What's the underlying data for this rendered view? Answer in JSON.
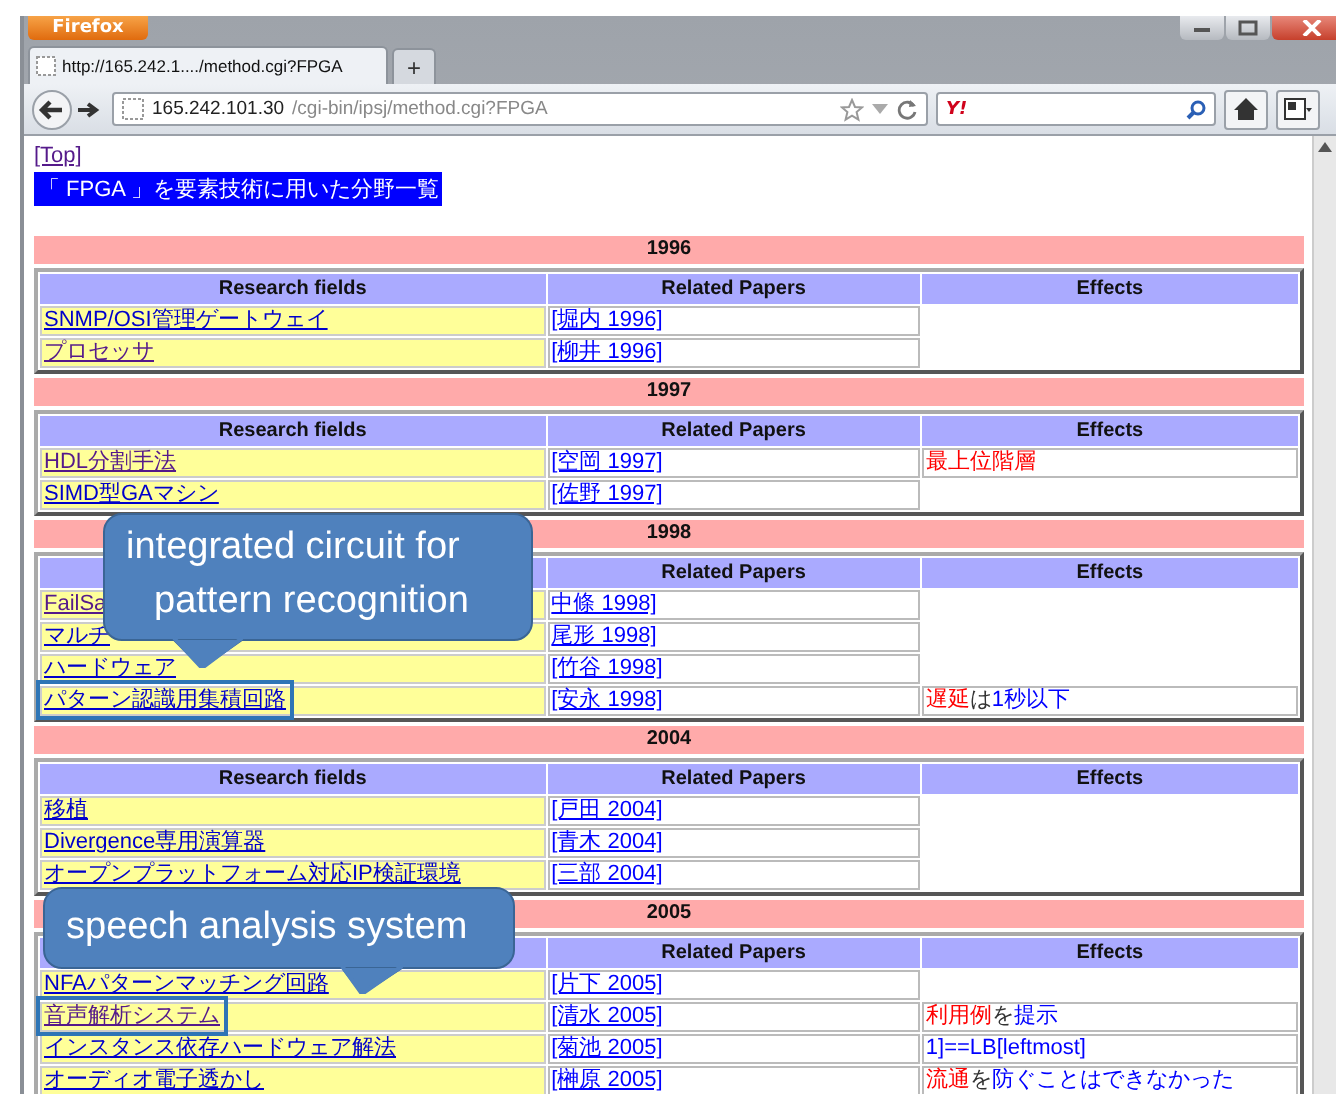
{
  "browser": {
    "menu_button": "Firefox",
    "tab_title": "http://165.242.1..../method.cgi?FPGA",
    "new_tab": "+",
    "address_host": "165.242.101.30",
    "address_path": "/cgi-bin/ipsj/method.cgi?FPGA",
    "search_logo": "Y!"
  },
  "page": {
    "top_link": "[Top]",
    "heading": "「 FPGA 」を要素技術に用いた分野一覧"
  },
  "sections": [
    {
      "year": "1996",
      "headers": {
        "field": "Research fields",
        "papers": "Related Papers",
        "effects": "Effects"
      },
      "rows": [
        {
          "field": "SNMP/OSI管理ゲートウェイ",
          "visited": false,
          "highlighted": false,
          "paper": "[堀内 1996]"
        },
        {
          "field": "プロセッサ",
          "visited": true,
          "highlighted": false,
          "paper": "[柳井 1996]"
        }
      ]
    },
    {
      "year": "1997",
      "headers": {
        "field": "Research fields",
        "papers": "Related Papers",
        "effects": "Effects"
      },
      "rows": [
        {
          "field": "HDL分割手法",
          "visited": true,
          "highlighted": false,
          "paper": "[空岡 1997]",
          "effects": [
            {
              "text": "最上位階層",
              "kind": "alert"
            }
          ]
        },
        {
          "field": "SIMD型GAマシン",
          "visited": false,
          "highlighted": false,
          "paper": "[佐野 1997]"
        }
      ]
    },
    {
      "year": "1998",
      "headers": {
        "papers": "Related Papers",
        "effects": "Effects"
      },
      "rows": [
        {
          "field": "FailSa",
          "visited": true,
          "highlighted": false,
          "paper": "中條 1998]"
        },
        {
          "field": "マルチ",
          "visited": false,
          "highlighted": false,
          "paper": "尾形 1998]"
        },
        {
          "field": "ハードウェア",
          "visited": false,
          "highlighted": false,
          "paper": "[竹谷 1998]"
        },
        {
          "field": "パターン認識用集積回路",
          "visited": false,
          "highlighted": true,
          "paper": "[安永 1998]",
          "effects": [
            {
              "text": "遅延",
              "kind": "alert"
            },
            {
              "text": "は",
              "kind": "plain"
            },
            {
              "text": "1秒以下",
              "kind": "link"
            }
          ]
        }
      ]
    },
    {
      "year": "2004",
      "headers": {
        "field": "Research fields",
        "papers": "Related Papers",
        "effects": "Effects"
      },
      "rows": [
        {
          "field": "移植",
          "visited": false,
          "highlighted": false,
          "paper": "[戸田 2004]"
        },
        {
          "field": "Divergence専用演算器",
          "visited": false,
          "highlighted": false,
          "paper": "[青木 2004]"
        },
        {
          "field": "オープンプラットフォーム対応IP検証環境",
          "visited": false,
          "highlighted": false,
          "paper": "[三部 2004]"
        }
      ]
    },
    {
      "year": "2005",
      "headers": {
        "papers": "Related Papers",
        "effects": "Effects"
      },
      "rows": [
        {
          "field": "NFAパターンマッチング回路",
          "visited": false,
          "highlighted": false,
          "paper": "[片下 2005]"
        },
        {
          "field": "音声解析システム",
          "visited": true,
          "highlighted": true,
          "paper": "[清水 2005]",
          "effects": [
            {
              "text": "利用例",
              "kind": "alert"
            },
            {
              "text": "を",
              "kind": "plain"
            },
            {
              "text": "提示",
              "kind": "link"
            }
          ]
        },
        {
          "field": "インスタンス依存ハードウェア解法",
          "visited": false,
          "highlighted": false,
          "paper": "[菊池 2005]",
          "effects": [
            {
              "text": "1]==LB[leftmost]",
              "kind": "link"
            }
          ]
        },
        {
          "field": "オーディオ電子透かし",
          "visited": false,
          "highlighted": false,
          "paper": "[榊原 2005]",
          "effects": [
            {
              "text": "流通",
              "kind": "alert"
            },
            {
              "text": "を",
              "kind": "plain"
            },
            {
              "text": "防ぐことはできなかった",
              "kind": "link"
            }
          ]
        }
      ]
    }
  ],
  "callouts": [
    {
      "lines": [
        "integrated circuit for",
        "pattern recognition"
      ]
    },
    {
      "lines": [
        "speech analysis system"
      ]
    }
  ]
}
